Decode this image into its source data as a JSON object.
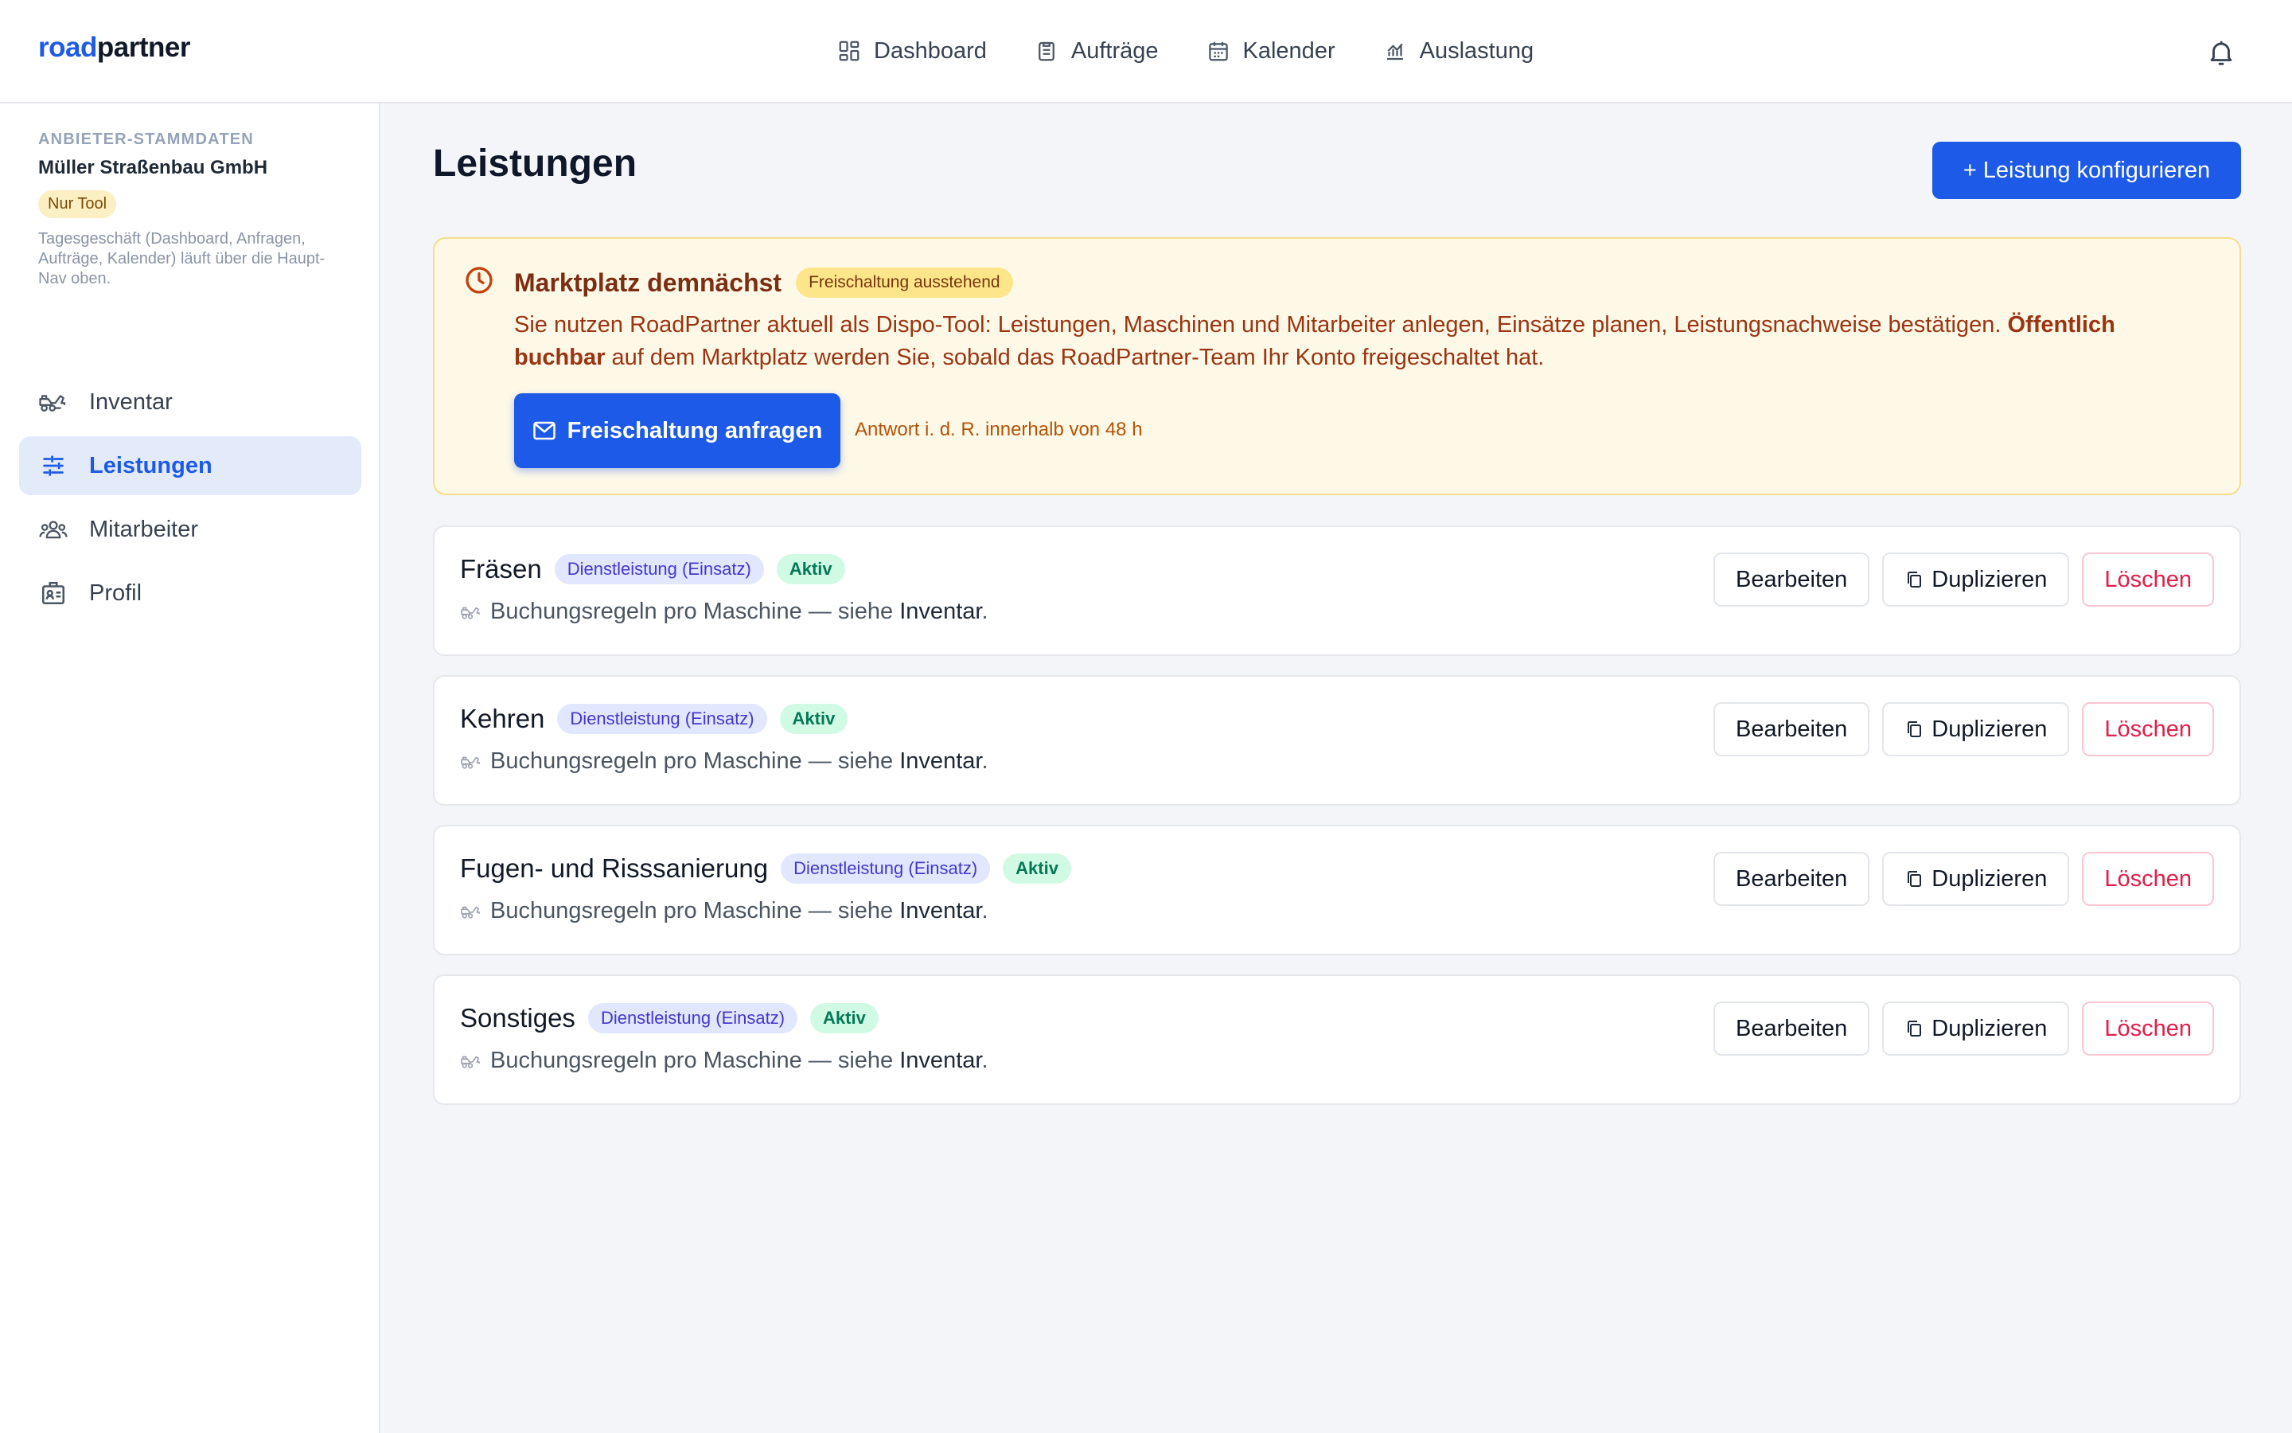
{
  "brand": {
    "part1": "road",
    "part2": "partner"
  },
  "topnav": [
    {
      "label": "Dashboard",
      "icon": "dashboard-icon"
    },
    {
      "label": "Aufträge",
      "icon": "clipboard-icon"
    },
    {
      "label": "Kalender",
      "icon": "calendar-icon"
    },
    {
      "label": "Auslastung",
      "icon": "chart-icon"
    }
  ],
  "sidebar": {
    "kicker": "ANBIETER-STAMMDATEN",
    "company": "Müller Straßenbau GmbH",
    "badge": "Nur Tool",
    "note": "Tagesgeschäft (Dashboard, Anfragen, Aufträge, Kalender) läuft über die Haupt-Nav oben.",
    "items": [
      {
        "label": "Inventar",
        "icon": "truck-icon",
        "active": false
      },
      {
        "label": "Leistungen",
        "icon": "sliders-icon",
        "active": true
      },
      {
        "label": "Mitarbeiter",
        "icon": "people-icon",
        "active": false
      },
      {
        "label": "Profil",
        "icon": "id-card-icon",
        "active": false
      }
    ]
  },
  "main": {
    "title": "Leistungen",
    "primary_button": "+ Leistung konfigurieren"
  },
  "banner": {
    "title": "Marktplatz demnächst",
    "pill": "Freischaltung ausstehend",
    "text_before": "Sie nutzen RoadPartner aktuell als Dispo-Tool: Leistungen, Maschinen und Mitarbeiter anlegen, Einsätze planen, Leistungsnachweise bestätigen. ",
    "text_bold": "Öffentlich buchbar",
    "text_after": " auf dem Marktplatz werden Sie, sobald das RoadPartner-Team Ihr Konto freigeschaltet hat.",
    "button": "Freischaltung anfragen",
    "hint": "Antwort i. d. R. innerhalb von 48 h"
  },
  "services": [
    {
      "name": "Fräsen",
      "type": "Dienstleistung (Einsatz)",
      "status": "Aktiv"
    },
    {
      "name": "Kehren",
      "type": "Dienstleistung (Einsatz)",
      "status": "Aktiv"
    },
    {
      "name": "Fugen- und Risssanierung",
      "type": "Dienstleistung (Einsatz)",
      "status": "Aktiv"
    },
    {
      "name": "Sonstiges",
      "type": "Dienstleistung (Einsatz)",
      "status": "Aktiv"
    }
  ],
  "card_common": {
    "sub_text": "Buchungsregeln pro Maschine — siehe ",
    "sub_link": "Inventar",
    "sub_end": ".",
    "edit": "Bearbeiten",
    "duplicate": "Duplizieren",
    "delete": "Löschen"
  },
  "colors": {
    "accent": "#1d5ae8",
    "banner_bg": "#fef9e7",
    "danger": "#e11d48",
    "success": "#047857"
  }
}
